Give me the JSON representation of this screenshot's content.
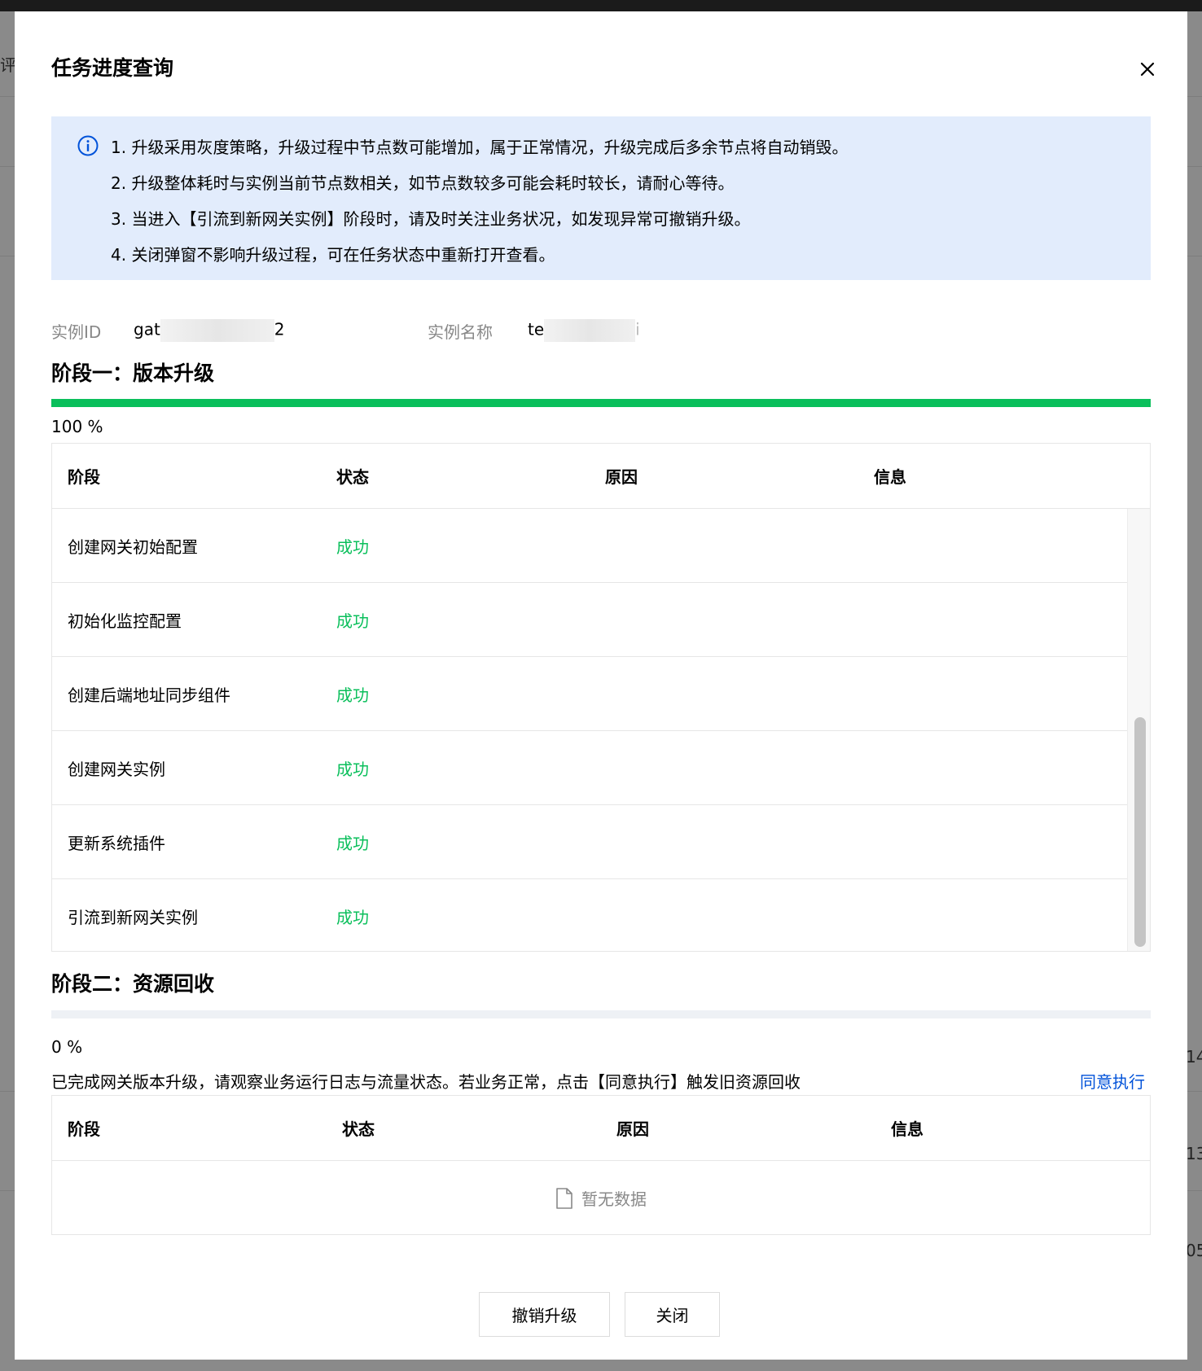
{
  "background": {
    "left_chars": [
      "评"
    ],
    "right_chars": [
      "14",
      "13",
      "05"
    ]
  },
  "dialog": {
    "title": "任务进度查询",
    "close_icon": "close-icon",
    "info": {
      "icon": "info-icon",
      "lines": [
        "1. 升级采用灰度策略，升级过程中节点数可能增加，属于正常情况，升级完成后多余节点将自动销毁。",
        "2. 升级整体耗时与实例当前节点数相关，如节点数较多可能会耗时较长，请耐心等待。",
        "3. 当进入【引流到新网关实例】阶段时，请及时关注业务状况，如发现异常可撤销升级。",
        "4. 关闭弹窗不影响升级过程，可在任务状态中重新打开查看。"
      ]
    },
    "instance": {
      "id_label": "实例ID",
      "id_prefix": "gat",
      "id_suffix": "2",
      "name_label": "实例名称",
      "name_prefix": "te",
      "name_suffix": "i"
    },
    "stage1": {
      "title": "阶段一：版本升级",
      "progress_percent": 100,
      "progress_text": "100 %",
      "columns": [
        "阶段",
        "状态",
        "原因",
        "信息"
      ],
      "rows": [
        {
          "stage": "创建网关初始配置",
          "status": "成功",
          "reason": "",
          "info": ""
        },
        {
          "stage": "初始化监控配置",
          "status": "成功",
          "reason": "",
          "info": ""
        },
        {
          "stage": "创建后端地址同步组件",
          "status": "成功",
          "reason": "",
          "info": ""
        },
        {
          "stage": "创建网关实例",
          "status": "成功",
          "reason": "",
          "info": ""
        },
        {
          "stage": "更新系统插件",
          "status": "成功",
          "reason": "",
          "info": ""
        },
        {
          "stage": "引流到新网关实例",
          "status": "成功",
          "reason": "",
          "info": ""
        }
      ]
    },
    "stage2": {
      "title": "阶段二：资源回收",
      "progress_percent": 0,
      "progress_text": "0 %",
      "hint": "已完成网关版本升级，请观察业务运行日志与流量状态。若业务正常，点击【同意执行】触发旧资源回收",
      "agree_link": "同意执行",
      "columns": [
        "阶段",
        "状态",
        "原因",
        "信息"
      ],
      "empty_icon": "document-icon",
      "empty_text": "暂无数据"
    },
    "buttons": {
      "revoke": "撤销升级",
      "close": "关闭"
    },
    "colors": {
      "success": "#0abf5b",
      "link": "#0052d9",
      "info_bg": "#e2ecfc"
    }
  }
}
